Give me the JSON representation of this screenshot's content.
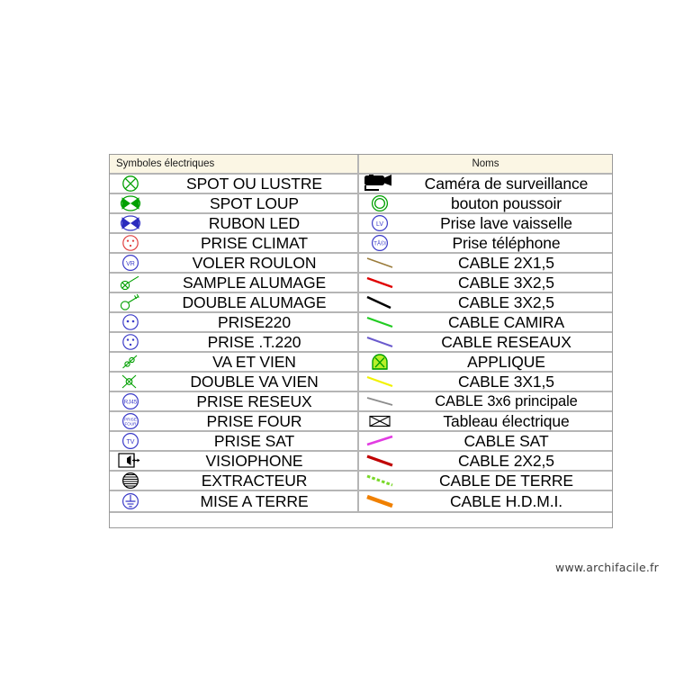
{
  "table": {
    "header": {
      "left": "Symboles électriques",
      "right": "Noms"
    },
    "left_rows": [
      {
        "icon": "circle-cross-green",
        "label": "SPOT OU LUSTRE"
      },
      {
        "icon": "ellipse-bowtie-green-filled",
        "label": "SPOT LOUP"
      },
      {
        "icon": "ellipse-bowtie-blue-filled",
        "label": "RUBON LED"
      },
      {
        "icon": "socket-three-dot-red",
        "label": "PRISE CLIMAT"
      },
      {
        "icon": "circle-vr-blue",
        "label": "VOLER ROULON"
      },
      {
        "icon": "switch-simple-crossed-green",
        "label": "SAMPLE ALUMAGE"
      },
      {
        "icon": "switch-double-green",
        "label": "DOUBLE ALUMAGE"
      },
      {
        "icon": "socket-two-dot-blue",
        "label": "PRISE220"
      },
      {
        "icon": "socket-three-dot-blue",
        "label": "PRISE .T.220"
      },
      {
        "icon": "switch-va-et-vient-green",
        "label": "VA ET VIEN"
      },
      {
        "icon": "switch-double-va-vient-green",
        "label": "DOUBLE VA VIEN"
      },
      {
        "icon": "circle-rj45-blue",
        "label": "PRISE RESEUX"
      },
      {
        "icon": "circle-four-blue",
        "label": "PRISE FOUR"
      },
      {
        "icon": "circle-tv-blue",
        "label": "PRISE SAT"
      },
      {
        "icon": "visiophone-box",
        "label": "VISIOPHONE"
      },
      {
        "icon": "extractor-hatched-circle",
        "label": "EXTRACTEUR"
      },
      {
        "icon": "earth-ground-blue",
        "label": "MISE A TERRE"
      }
    ],
    "right_rows": [
      {
        "icon": "camera-black",
        "label": "Caméra de surveillance"
      },
      {
        "icon": "double-circle-green",
        "label": "bouton poussoir"
      },
      {
        "icon": "circle-lv-blue",
        "label": "Prise lave vaisselle"
      },
      {
        "icon": "circle-tel-blue",
        "label": "Prise téléphone"
      },
      {
        "icon": "line-brown",
        "label": "CABLE 2X1,5"
      },
      {
        "icon": "line-red",
        "label": "CABLE 3X2,5"
      },
      {
        "icon": "line-black",
        "label": "CABLE 3X2,5"
      },
      {
        "icon": "line-green",
        "label": "CABLE CAMIRA"
      },
      {
        "icon": "line-violet",
        "label": "CABLE RESEAUX"
      },
      {
        "icon": "applique-dome-green",
        "label": "APPLIQUE"
      },
      {
        "icon": "line-yellow",
        "label": "CABLE 3X1,5"
      },
      {
        "icon": "line-grey",
        "label": "CABLE 3x6 principale"
      },
      {
        "icon": "rect-cross-box",
        "label": "Tableau électrique"
      },
      {
        "icon": "line-magenta",
        "label": "CABLE SAT"
      },
      {
        "icon": "line-dark-red-thick",
        "label": "CABLE 2X2,5"
      },
      {
        "icon": "line-green-dashed",
        "label": "CABLE DE TERRE"
      },
      {
        "icon": "line-orange-thick",
        "label": "CABLE H.D.M.I."
      }
    ]
  },
  "watermark": "www.archifacile.fr",
  "colors": {
    "green": "#00a000",
    "blue": "#3b3bc8",
    "red": "#e00000",
    "brown": "#9a7b3a",
    "black": "#000000",
    "violet": "#6a5acd",
    "yellow": "#f2f200",
    "grey": "#8c8c8c",
    "magenta": "#e23ce2",
    "orange": "#f08000",
    "header_bg": "#fbf6e4",
    "border": "#b5b5b5"
  }
}
